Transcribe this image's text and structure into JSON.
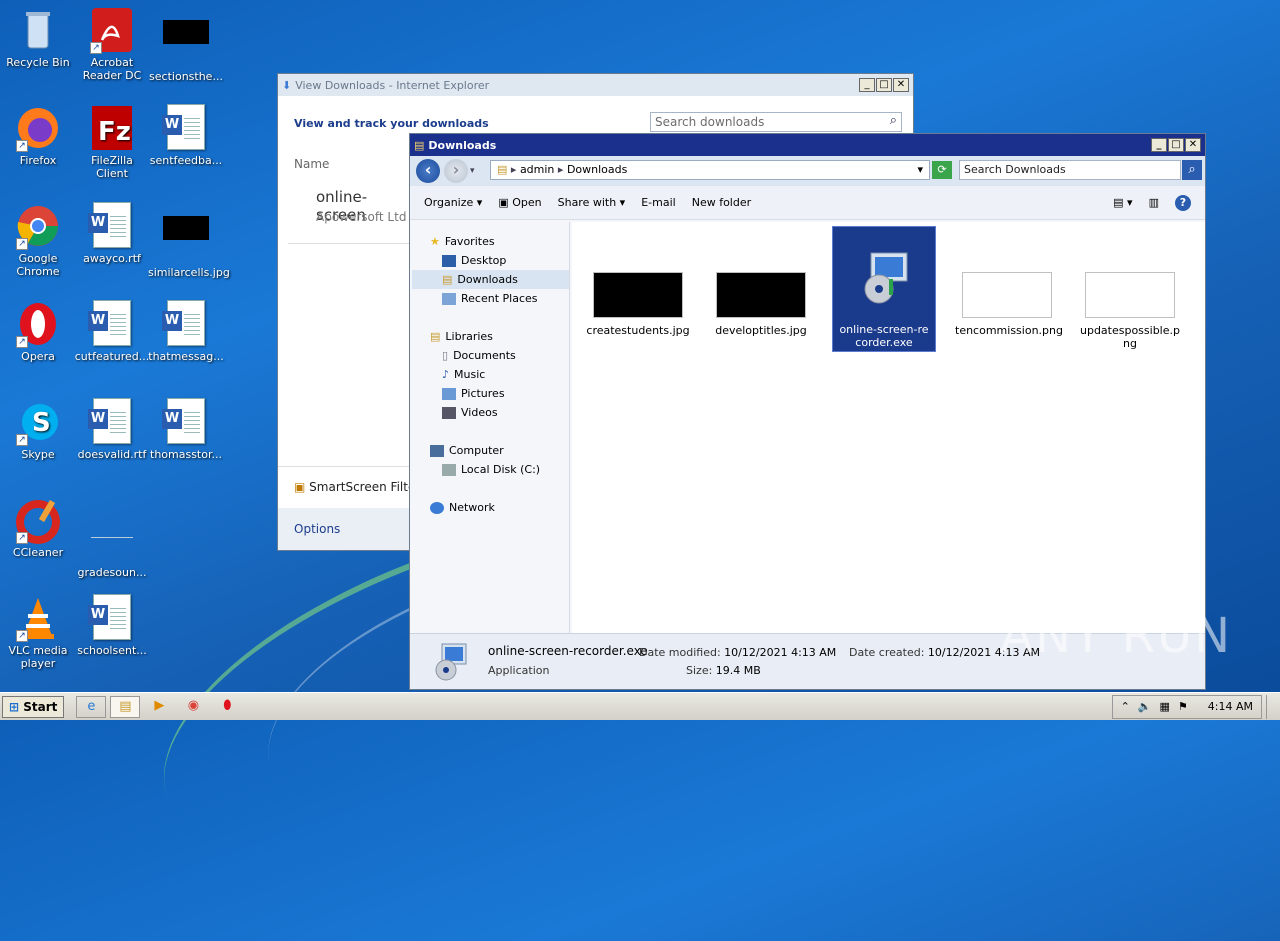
{
  "desktop": {
    "icons": [
      {
        "label": "Recycle Bin",
        "icon": "recycle-bin-icon"
      },
      {
        "label": "Acrobat Reader DC",
        "icon": "acrobat-icon"
      },
      {
        "label": "sectionsthe...",
        "icon": "image-file-icon"
      },
      {
        "label": "Firefox",
        "icon": "firefox-icon"
      },
      {
        "label": "FileZilla Client",
        "icon": "filezilla-icon"
      },
      {
        "label": "sentfeedba...",
        "icon": "word-document-icon"
      },
      {
        "label": "Google Chrome",
        "icon": "chrome-icon"
      },
      {
        "label": "awayco.rtf",
        "icon": "word-document-icon"
      },
      {
        "label": "similarcells.jpg",
        "icon": "image-file-icon"
      },
      {
        "label": "Opera",
        "icon": "opera-icon"
      },
      {
        "label": "cutfeatured...",
        "icon": "word-document-icon"
      },
      {
        "label": "thatmessag...",
        "icon": "word-document-icon"
      },
      {
        "label": "Skype",
        "icon": "skype-icon"
      },
      {
        "label": "doesvalid.rtf",
        "icon": "word-document-icon"
      },
      {
        "label": "thomasstor...",
        "icon": "word-document-icon"
      },
      {
        "label": "CCleaner",
        "icon": "ccleaner-icon"
      },
      {
        "label": "gradesoun...",
        "icon": "file-icon"
      },
      {
        "label": "VLC media player",
        "icon": "vlc-icon"
      },
      {
        "label": "schoolsent...",
        "icon": "word-document-icon"
      }
    ]
  },
  "ie_window": {
    "title": "View Downloads - Internet Explorer",
    "heading": "View and track your downloads",
    "search_placeholder": "Search downloads",
    "col_name": "Name",
    "item_name": "online-screen",
    "item_publisher": "Apowersoft Ltd",
    "smartscreen": "SmartScreen Filte",
    "options": "Options"
  },
  "explorer": {
    "title": "Downloads",
    "crumb_user": "admin",
    "crumb_folder": "Downloads",
    "search_placeholder": "Search Downloads",
    "toolbar": {
      "organize": "Organize",
      "open": "Open",
      "share_with": "Share with",
      "email": "E-mail",
      "new_folder": "New folder"
    },
    "nav": {
      "favorites": "Favorites",
      "desktop": "Desktop",
      "downloads": "Downloads",
      "recent_places": "Recent Places",
      "libraries": "Libraries",
      "documents": "Documents",
      "music": "Music",
      "pictures": "Pictures",
      "videos": "Videos",
      "computer": "Computer",
      "local_disk": "Local Disk (C:)",
      "network": "Network"
    },
    "files": [
      {
        "name": "createstudents.jpg"
      },
      {
        "name": "developtitles.jpg"
      },
      {
        "name": "online-screen-recorder.exe"
      },
      {
        "name": "tencommission.png"
      },
      {
        "name": "updatespossible.png"
      }
    ],
    "details": {
      "filename": "online-screen-recorder.exe",
      "type": "Application",
      "modified_label": "Date modified:",
      "modified_value": "10/12/2021 4:13 AM",
      "size_label": "Size:",
      "size_value": "19.4 MB",
      "created_label": "Date created:",
      "created_value": "10/12/2021 4:13 AM"
    }
  },
  "taskbar": {
    "start": "Start",
    "clock": "4:14 AM"
  },
  "watermark": "ANY RUN"
}
